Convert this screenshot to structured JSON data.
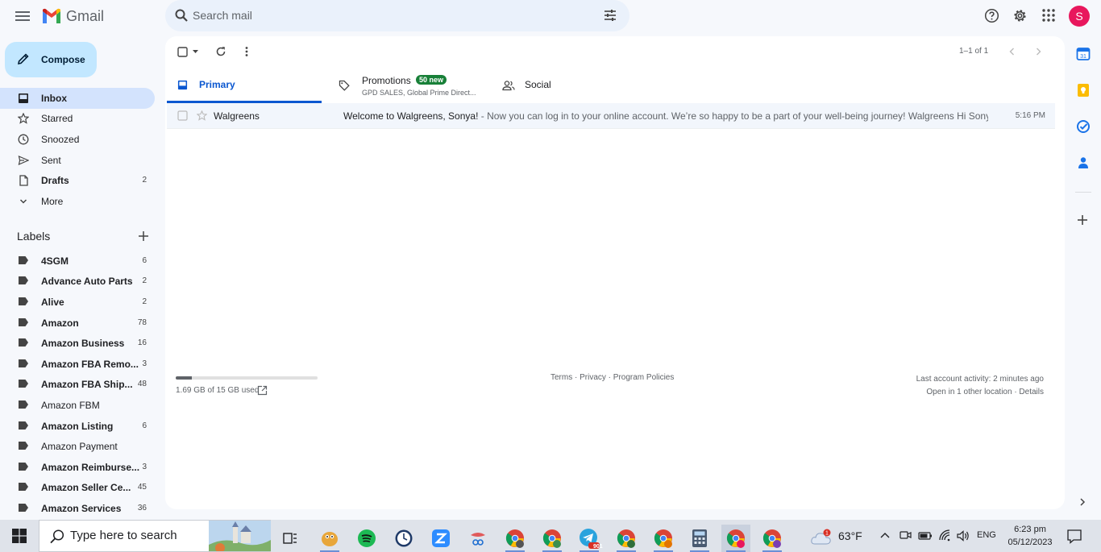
{
  "header": {
    "app_name": "Gmail",
    "search_placeholder": "Search mail",
    "avatar_letter": "S"
  },
  "nav": {
    "compose_label": "Compose",
    "items": [
      {
        "label": "Inbox",
        "count": "",
        "icon": "inbox-icon",
        "active": true
      },
      {
        "label": "Starred",
        "count": "",
        "icon": "star-icon"
      },
      {
        "label": "Snoozed",
        "count": "",
        "icon": "clock-icon"
      },
      {
        "label": "Sent",
        "count": "",
        "icon": "send-icon"
      },
      {
        "label": "Drafts",
        "count": "2",
        "icon": "draft-icon"
      },
      {
        "label": "More",
        "count": "",
        "icon": "chevron-down-icon"
      }
    ],
    "labels_title": "Labels",
    "labels": [
      {
        "label": "4SGM",
        "count": "6"
      },
      {
        "label": "Advance Auto Parts",
        "count": "2"
      },
      {
        "label": "Alive",
        "count": "2"
      },
      {
        "label": "Amazon",
        "count": "78"
      },
      {
        "label": "Amazon Business",
        "count": "16"
      },
      {
        "label": "Amazon FBA Remo...",
        "count": "3"
      },
      {
        "label": "Amazon FBA Ship...",
        "count": "48"
      },
      {
        "label": "Amazon FBM",
        "count": ""
      },
      {
        "label": "Amazon Listing",
        "count": "6"
      },
      {
        "label": "Amazon Payment",
        "count": ""
      },
      {
        "label": "Amazon Reimburse...",
        "count": "3"
      },
      {
        "label": "Amazon Seller Ce...",
        "count": "45"
      },
      {
        "label": "Amazon Services",
        "count": "36"
      }
    ]
  },
  "toolbar": {
    "pager": "1–1 of 1"
  },
  "tabs": {
    "primary": "Primary",
    "promotions": "Promotions",
    "promotions_badge": "50 new",
    "promotions_sub": "GPD SALES, Global Prime Direct...",
    "social": "Social"
  },
  "emails": [
    {
      "sender": "Walgreens",
      "subject": "Welcome to Walgreens, Sonya!",
      "snippet": " - Now you can log in to your online account. We’re so happy to be a part of your well-being journey! Walgreens Hi Sonya, We...",
      "time": "5:16 PM"
    }
  ],
  "footer": {
    "storage_used_fraction": 0.113,
    "storage_text": "1.69 GB of 15 GB used",
    "links": "Terms · Privacy · Program Policies",
    "activity": "Last account activity: 2 minutes ago",
    "location": "Open in 1 other location · Details"
  },
  "taskbar": {
    "search_placeholder": "Type here to search",
    "temperature": "63°F",
    "language": "ENG",
    "time": "6:23 pm",
    "date": "05/12/2023",
    "telegram_badge": "901"
  },
  "colors": {
    "accent": "#0b57d0",
    "compose_bg": "#c2e7ff",
    "active_nav_bg": "#d3e3fd",
    "promo_badge": "#188038",
    "avatar": "#e8175d"
  }
}
